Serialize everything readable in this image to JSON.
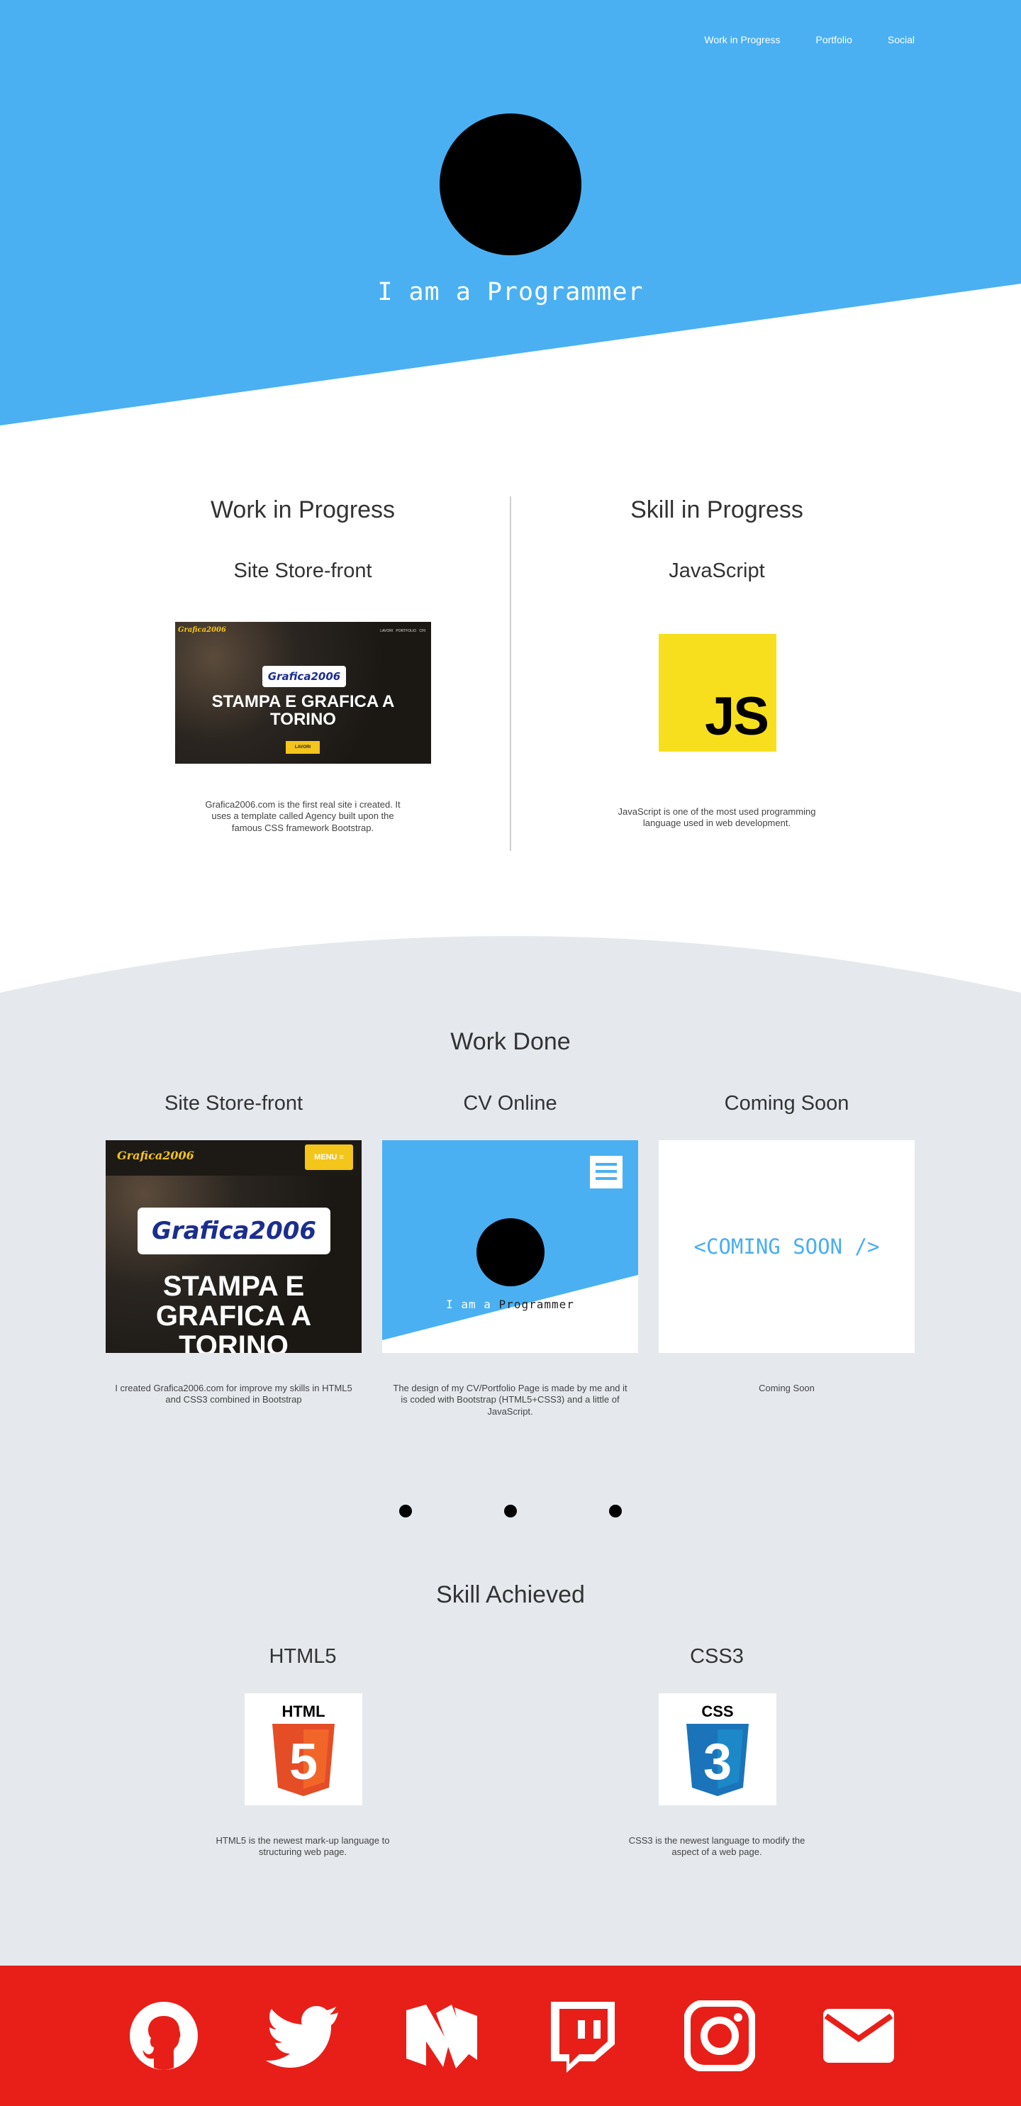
{
  "nav": {
    "items": [
      "Work in Progress",
      "Portfolio",
      "Social"
    ]
  },
  "hero": {
    "title": "I am a Programmer"
  },
  "work_in_progress": {
    "heading": "Work in Progress",
    "project_title": "Site Store-front",
    "description": "Grafica2006.com is the first real site i created. It uses a template called Agency built upon the famous CSS framework Bootstrap.",
    "thumb": {
      "brand": "Grafica2006",
      "logo": "Grafica2006",
      "headline": "STAMPA E GRAFICA A TORINO",
      "button": "LAVORI",
      "nav": [
        "LAVORI",
        "PORTFOLIO",
        "CHI"
      ]
    }
  },
  "skill_in_progress": {
    "heading": "Skill in Progress",
    "skill_title": "JavaScript",
    "logo_text": "JS",
    "description": "JavaScript is one of the most used programming language used in web development."
  },
  "work_done": {
    "heading": "Work Done",
    "cards": [
      {
        "title": "Site Store-front",
        "description": "I created Grafica2006.com for improve my skills in HTML5 and CSS3 combined in Bootstrap",
        "thumb": {
          "brand": "Grafica2006",
          "menu": "MENU ≡",
          "logo": "Grafica2006",
          "headline": "STAMPA E GRAFICA A TORINO"
        }
      },
      {
        "title": "CV Online",
        "description": "The design of my CV/Portfolio Page is made by me and it is coded with Bootstrap (HTML5+CSS3) and a little of JavaScript.",
        "thumb": {
          "title_a": "I am a ",
          "title_b": "Programmer"
        }
      },
      {
        "title": "Coming Soon",
        "description": "Coming Soon",
        "thumb": {
          "text": "<COMING SOON />"
        }
      }
    ]
  },
  "skill_achieved": {
    "heading": "Skill Achieved",
    "skills": [
      {
        "title": "HTML5",
        "logo_label": "HTML",
        "logo_number": "5",
        "description": "HTML5 is the newest mark-up language to structuring web page."
      },
      {
        "title": "CSS3",
        "logo_label": "CSS",
        "logo_number": "3",
        "description": "CSS3 is the newest language to modify the aspect of a web page."
      }
    ]
  },
  "footer": {
    "social_icons": [
      "github-icon",
      "twitter-icon",
      "medium-icon",
      "twitch-icon",
      "instagram-icon",
      "mail-icon"
    ]
  },
  "colors": {
    "hero_blue": "#4ab0f2",
    "section_gray": "#e5e9ee",
    "footer_red": "#e81f19",
    "js_yellow": "#f7df1e",
    "html_orange": "#e44d26",
    "css_blue": "#1b73ba"
  }
}
